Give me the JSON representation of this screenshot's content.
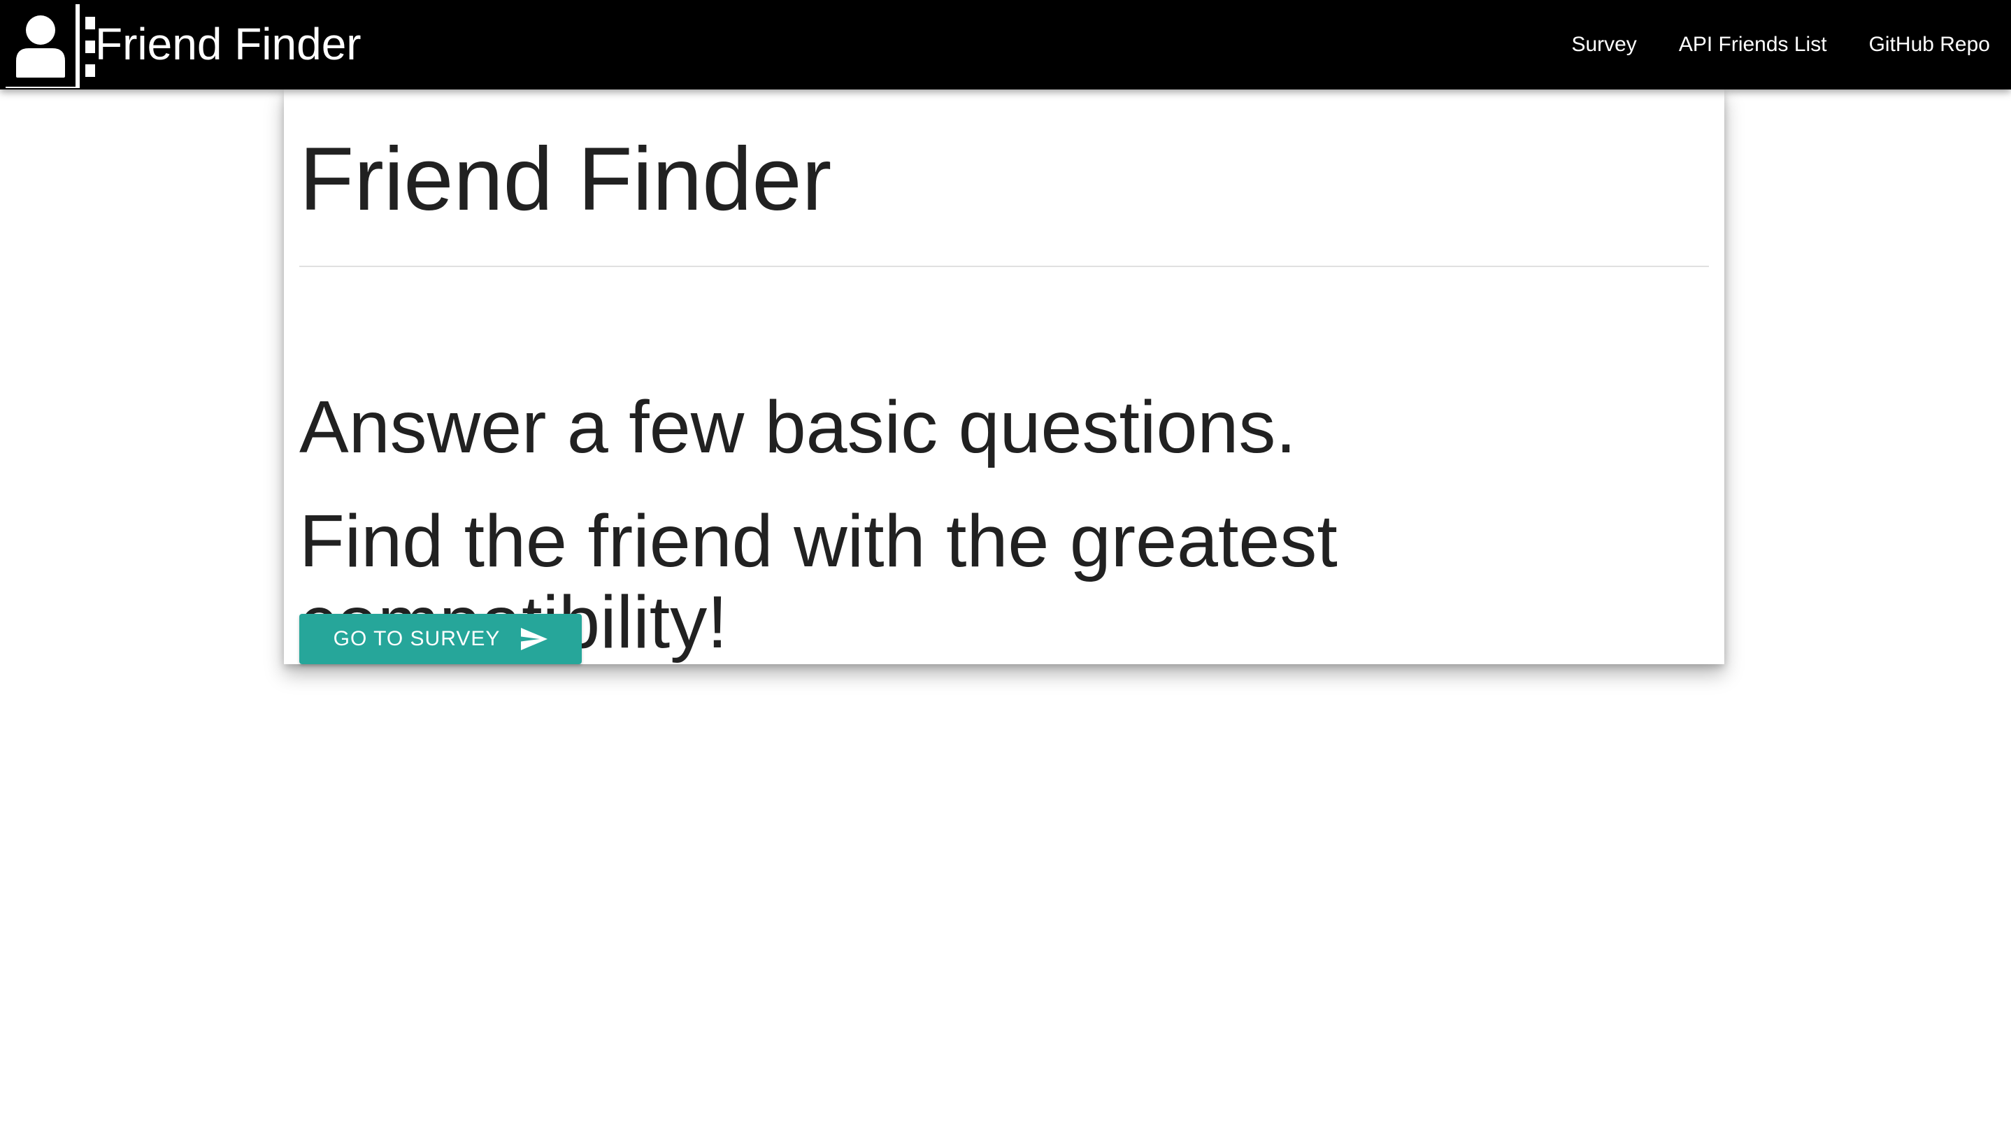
{
  "navbar": {
    "logo_icon": "person-icon",
    "brand_title": "Friend Finder",
    "links": [
      {
        "label": "Survey"
      },
      {
        "label": "API Friends List"
      },
      {
        "label": "GitHub Repo"
      }
    ],
    "background_color": "#000000"
  },
  "main": {
    "title": "Friend Finder",
    "line1": "Answer a few basic questions.",
    "line2": "Find the friend with the greatest compatibility!",
    "button": {
      "label": "GO TO SURVEY",
      "icon": "send-icon",
      "color": "#26a69a"
    }
  }
}
